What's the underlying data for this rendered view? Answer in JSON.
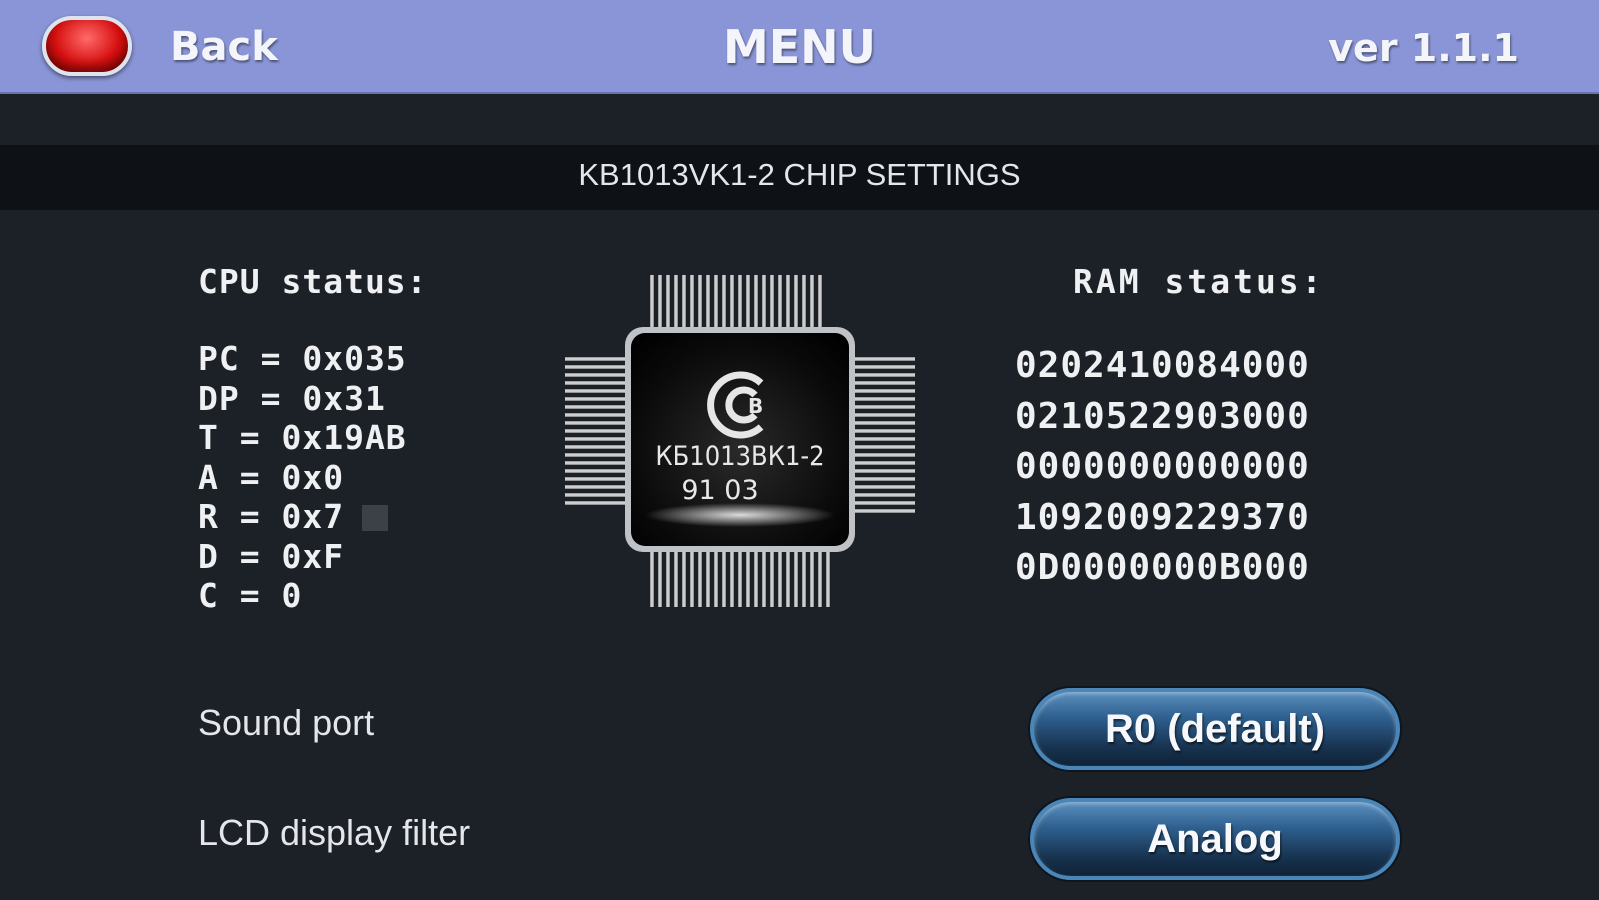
{
  "header": {
    "back_label": "Back",
    "title": "MENU",
    "version": "ver 1.1.1"
  },
  "section": {
    "title": "KB1013VK1-2 CHIP SETTINGS"
  },
  "cpu": {
    "heading": "CPU status:",
    "registers": [
      "PC = 0x035",
      "DP = 0x31",
      "T = 0x19AB",
      "A = 0x0",
      "R = 0x7",
      "D = 0xF",
      "C = 0"
    ]
  },
  "chip": {
    "marking_line1": "КБ1013ВК1-2",
    "marking_line2": "91 03",
    "logo_letter": "В"
  },
  "ram": {
    "heading": "RAM status:",
    "rows": [
      "0202410084000",
      "0210522903000",
      "0000000000000",
      "1092009229370",
      "0D0000000B000"
    ]
  },
  "settings": {
    "sound_port": {
      "label": "Sound port",
      "value": "R0 (default)"
    },
    "lcd_filter": {
      "label": "LCD display filter",
      "value": "Analog"
    }
  },
  "colors": {
    "header_bg": "#8995d6",
    "body_bg": "#1c2027",
    "section_bg": "#0e1115",
    "button_blue": "#2e5f8e",
    "back_button_red": "#d61010"
  }
}
